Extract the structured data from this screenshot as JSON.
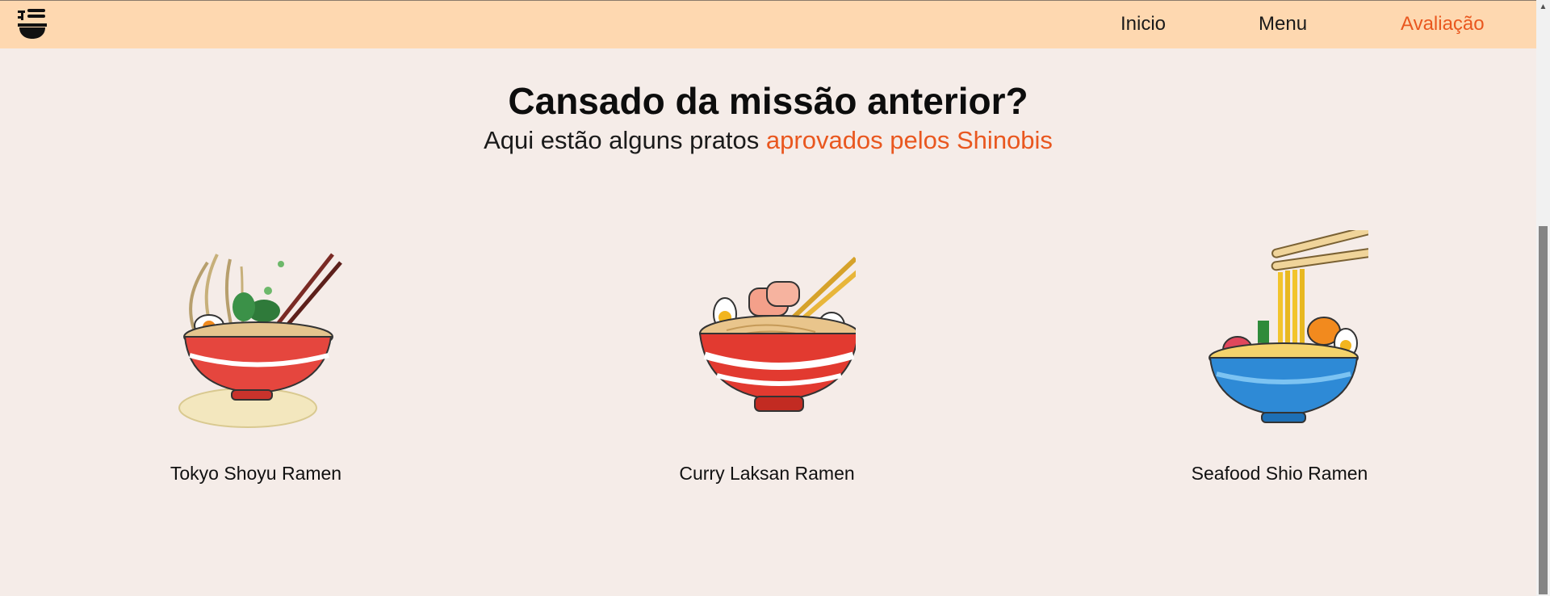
{
  "nav": {
    "logo_icon": "ramen-bowl-logo-icon",
    "links": [
      {
        "label": "Inicio",
        "active": false
      },
      {
        "label": "Menu",
        "active": false
      },
      {
        "label": "Avaliação",
        "active": true
      }
    ]
  },
  "hero": {
    "title": "Cansado da missão anterior?",
    "subtitle_prefix": "Aqui estão alguns pratos ",
    "subtitle_highlight": "aprovados pelos Shinobis"
  },
  "dishes": [
    {
      "name": "Tokyo Shoyu Ramen",
      "icon": "ramen-bowl-red-icon"
    },
    {
      "name": "Curry Laksan Ramen",
      "icon": "ramen-bowl-shrimp-icon"
    },
    {
      "name": "Seafood Shio Ramen",
      "icon": "ramen-bowl-blue-icon"
    }
  ],
  "colors": {
    "accent": "#e9571f",
    "navbar_bg": "#fed8b0",
    "page_bg": "#f5ece8"
  }
}
